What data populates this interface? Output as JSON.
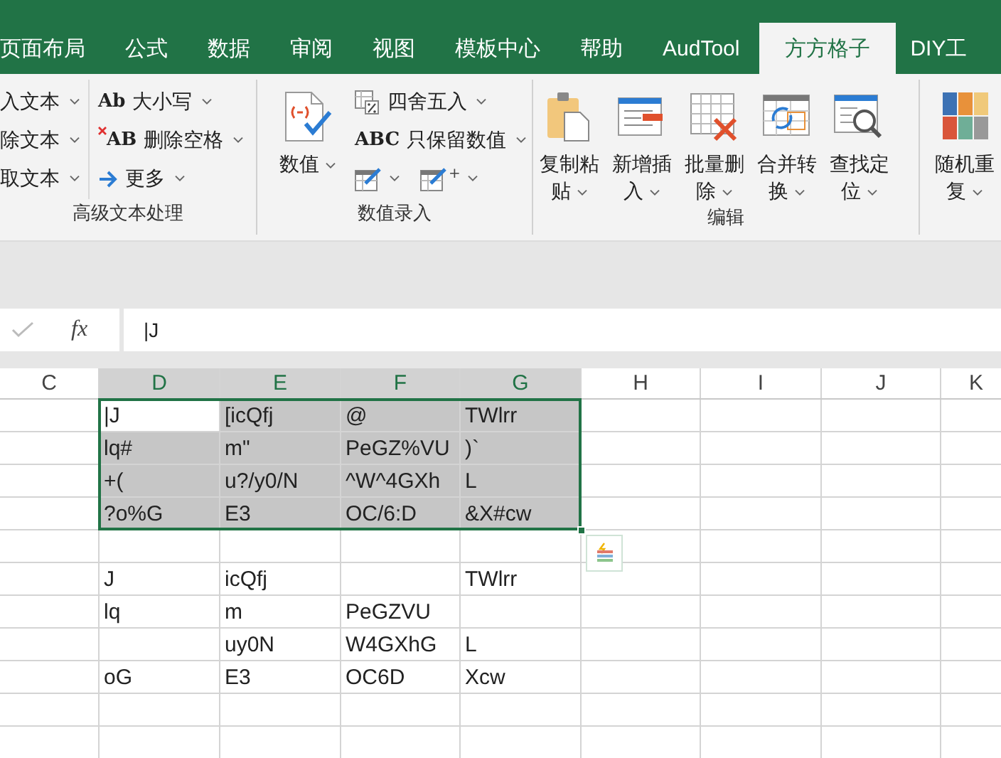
{
  "tabs": [
    {
      "label": "页面布局",
      "selected": false
    },
    {
      "label": "公式",
      "selected": false
    },
    {
      "label": "数据",
      "selected": false
    },
    {
      "label": "审阅",
      "selected": false
    },
    {
      "label": "视图",
      "selected": false
    },
    {
      "label": "模板中心",
      "selected": false
    },
    {
      "label": "帮助",
      "selected": false
    },
    {
      "label": "AudTool",
      "selected": false
    },
    {
      "label": "方方格子",
      "selected": true
    },
    {
      "label": "DIY工",
      "selected": false
    }
  ],
  "ribbon": {
    "groups": [
      {
        "label": "高级文本处理",
        "columns": [
          {
            "kind": "stack",
            "rows": [
              [
                {
                  "label": "入文本"
                }
              ],
              [
                {
                  "label": "除文本"
                }
              ],
              [
                {
                  "label": "取文本"
                }
              ]
            ]
          },
          {
            "kind": "stack",
            "rows": [
              [
                {
                  "icon_text": "Ab",
                  "label": "大小写"
                }
              ],
              [
                {
                  "icon_text": "AB",
                  "label": "删除空格"
                }
              ],
              [
                {
                  "label": "更多"
                }
              ]
            ]
          }
        ]
      },
      {
        "label": "数值录入",
        "columns": [
          {
            "kind": "large",
            "label": "数值"
          },
          {
            "kind": "stack",
            "rows": [
              [
                {
                  "label": "四舍五入"
                }
              ],
              [
                {
                  "icon_text": "ABC",
                  "label": "只保留数值"
                }
              ],
              [
                {},
                {
                  "icon_text": "+"
                }
              ]
            ]
          }
        ]
      },
      {
        "label": "编辑",
        "columns": [
          {
            "kind": "large",
            "label": "复制粘贴"
          },
          {
            "kind": "large",
            "label": "新增插入"
          },
          {
            "kind": "large",
            "label": "批量删除"
          },
          {
            "kind": "large",
            "label": "合并转换"
          },
          {
            "kind": "large",
            "label": "查找定位"
          }
        ]
      },
      {
        "columns": [
          {
            "kind": "large",
            "label": "随机重复"
          }
        ]
      }
    ]
  },
  "formula_bar": {
    "function_label": "fx",
    "value": "|J"
  },
  "sheet": {
    "columns": [
      {
        "label": "C",
        "selected": false
      },
      {
        "label": "D",
        "selected": true
      },
      {
        "label": "E",
        "selected": true
      },
      {
        "label": "F",
        "selected": true
      },
      {
        "label": "G",
        "selected": true
      },
      {
        "label": "H",
        "selected": false
      },
      {
        "label": "I",
        "selected": false
      },
      {
        "label": "J",
        "selected": false
      },
      {
        "label": "K",
        "selected": false
      }
    ],
    "rows": [
      {
        "selected": true,
        "cells": [
          null,
          {
            "text": "|J",
            "active": true
          },
          {
            "text": "[icQfj",
            "active": false
          },
          {
            "text": "@",
            "active": false
          },
          {
            "text": "TWlrr",
            "active": false
          },
          null,
          null,
          null,
          null
        ]
      },
      {
        "selected": true,
        "cells": [
          null,
          {
            "text": "lq#",
            "active": false
          },
          {
            "text": "m\"",
            "active": false
          },
          {
            "text": "PeGZ%VU",
            "active": false
          },
          {
            "text": ")`",
            "active": false
          },
          null,
          null,
          null,
          null
        ]
      },
      {
        "selected": true,
        "cells": [
          null,
          {
            "text": "+(",
            "active": false
          },
          {
            "text": "u?/y0/N",
            "active": false
          },
          {
            "text": "^W^4GXh",
            "active": false
          },
          {
            "text": "L",
            "active": false
          },
          null,
          null,
          null,
          null
        ]
      },
      {
        "selected": true,
        "cells": [
          null,
          {
            "text": "?o%G",
            "active": false
          },
          {
            "text": "E3",
            "active": false
          },
          {
            "text": "OC/6:D",
            "active": false
          },
          {
            "text": "&X#cw",
            "active": false
          },
          null,
          null,
          null,
          null
        ]
      },
      {
        "selected": false,
        "cells": [
          null,
          null,
          null,
          null,
          null,
          null,
          null,
          null,
          null
        ]
      },
      {
        "selected": false,
        "cells": [
          null,
          {
            "text": "J",
            "active": false
          },
          {
            "text": "icQfj",
            "active": false
          },
          null,
          {
            "text": "TWlrr",
            "active": false
          },
          null,
          null,
          null,
          null
        ]
      },
      {
        "selected": false,
        "cells": [
          null,
          {
            "text": "lq",
            "active": false
          },
          {
            "text": "m",
            "active": false
          },
          {
            "text": "PeGZVU",
            "active": false
          },
          null,
          null,
          null,
          null,
          null
        ]
      },
      {
        "selected": false,
        "cells": [
          null,
          null,
          {
            "text": "uy0N",
            "active": false
          },
          {
            "text": "W4GXhG",
            "active": false
          },
          {
            "text": "L",
            "active": false
          },
          null,
          null,
          null,
          null
        ]
      },
      {
        "selected": false,
        "cells": [
          null,
          {
            "text": "oG",
            "active": false
          },
          {
            "text": "E3",
            "active": false
          },
          {
            "text": "OC6D",
            "active": false
          },
          {
            "text": "Xcw",
            "active": false
          },
          null,
          null,
          null,
          null
        ]
      },
      {
        "selected": false,
        "cells": [
          null,
          null,
          null,
          null,
          null,
          null,
          null,
          null,
          null
        ]
      },
      {
        "selected": false,
        "cells": [
          null,
          null,
          null,
          null,
          null,
          null,
          null,
          null,
          null
        ]
      }
    ]
  }
}
